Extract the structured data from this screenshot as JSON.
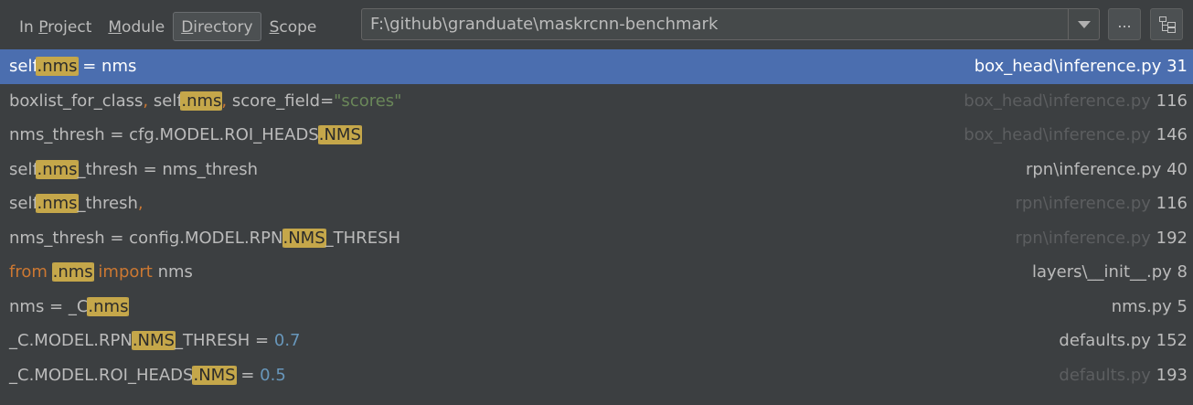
{
  "scope_tabs": [
    {
      "pre": "In ",
      "mn": "P",
      "post": "roject",
      "selected": false
    },
    {
      "pre": "",
      "mn": "M",
      "post": "odule",
      "selected": false
    },
    {
      "pre": "",
      "mn": "D",
      "post": "irectory",
      "selected": true
    },
    {
      "pre": "",
      "mn": "S",
      "post": "cope",
      "selected": false
    }
  ],
  "directory": {
    "value": "F:\\github\\granduate\\maskrcnn-benchmark"
  },
  "buttons": {
    "browse_label": "..."
  },
  "colors": {
    "selection": "#4b6eaf",
    "match_highlight": "#c5a74a",
    "keyword": "#cc7832",
    "string": "#6a8759",
    "number": "#6897bb"
  },
  "results": [
    {
      "selected": true,
      "code": [
        {
          "t": "self",
          "c": ""
        },
        {
          "t": ".nms",
          "c": "hl"
        },
        {
          "t": " = nms",
          "c": ""
        }
      ],
      "path": "box_head\\inference.py",
      "line": "31",
      "dim": false
    },
    {
      "selected": false,
      "code": [
        {
          "t": "boxlist_for_class",
          "c": ""
        },
        {
          "t": ",",
          "c": "kw"
        },
        {
          "t": " self",
          "c": ""
        },
        {
          "t": ".nms",
          "c": "hl"
        },
        {
          "t": ",",
          "c": "kw"
        },
        {
          "t": " score_field=",
          "c": ""
        },
        {
          "t": "\"scores\"",
          "c": "str"
        }
      ],
      "path": "box_head\\inference.py",
      "line": "116",
      "dim": true
    },
    {
      "selected": false,
      "code": [
        {
          "t": "nms_thresh = cfg.MODEL.ROI_HEADS",
          "c": ""
        },
        {
          "t": ".NMS",
          "c": "hl"
        }
      ],
      "path": "box_head\\inference.py",
      "line": "146",
      "dim": true
    },
    {
      "selected": false,
      "code": [
        {
          "t": "self",
          "c": ""
        },
        {
          "t": ".nms",
          "c": "hl"
        },
        {
          "t": "_thresh = nms_thresh",
          "c": ""
        }
      ],
      "path": "rpn\\inference.py",
      "line": "40",
      "dim": false
    },
    {
      "selected": false,
      "code": [
        {
          "t": "self",
          "c": ""
        },
        {
          "t": ".nms",
          "c": "hl"
        },
        {
          "t": "_thresh",
          "c": ""
        },
        {
          "t": ",",
          "c": "kw"
        }
      ],
      "path": "rpn\\inference.py",
      "line": "116",
      "dim": true
    },
    {
      "selected": false,
      "code": [
        {
          "t": "nms_thresh = config.MODEL.RPN",
          "c": ""
        },
        {
          "t": ".NMS",
          "c": "hl"
        },
        {
          "t": "_THRESH",
          "c": ""
        }
      ],
      "path": "rpn\\inference.py",
      "line": "192",
      "dim": true
    },
    {
      "selected": false,
      "code": [
        {
          "t": "from",
          "c": "kw"
        },
        {
          "t": " ",
          "c": ""
        },
        {
          "t": ".nms",
          "c": "hl"
        },
        {
          "t": " ",
          "c": ""
        },
        {
          "t": "import",
          "c": "kw"
        },
        {
          "t": " nms",
          "c": ""
        }
      ],
      "path": "layers\\__init__.py",
      "line": "8",
      "dim": false
    },
    {
      "selected": false,
      "code": [
        {
          "t": "nms = _C",
          "c": ""
        },
        {
          "t": ".nms",
          "c": "hl"
        }
      ],
      "path": "nms.py",
      "line": "5",
      "dim": false
    },
    {
      "selected": false,
      "code": [
        {
          "t": "_C.MODEL.RPN",
          "c": ""
        },
        {
          "t": ".NMS",
          "c": "hl"
        },
        {
          "t": "_THRESH = ",
          "c": ""
        },
        {
          "t": "0.7",
          "c": "num"
        }
      ],
      "path": "defaults.py",
      "line": "152",
      "dim": false
    },
    {
      "selected": false,
      "code": [
        {
          "t": "_C.MODEL.ROI_HEADS",
          "c": ""
        },
        {
          "t": ".NMS",
          "c": "hl"
        },
        {
          "t": " = ",
          "c": ""
        },
        {
          "t": "0.5",
          "c": "num"
        }
      ],
      "path": "defaults.py",
      "line": "193",
      "dim": true
    }
  ]
}
